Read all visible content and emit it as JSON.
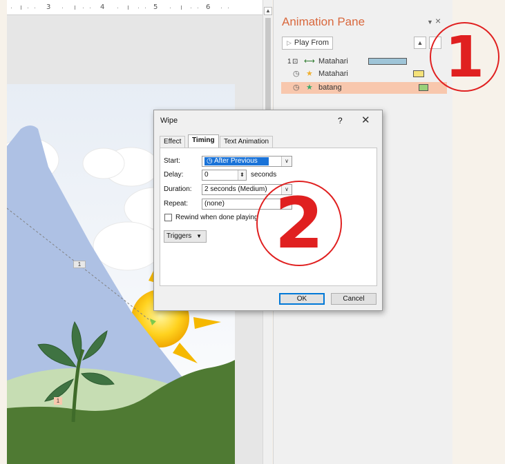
{
  "ruler": {
    "labels": [
      "3",
      "4",
      "5",
      "6"
    ]
  },
  "slide": {
    "tags": [
      "1",
      "1"
    ]
  },
  "animation_pane": {
    "title": "Animation Pane",
    "dropdown_icon": "chevron-down-icon",
    "close_icon": "close-icon",
    "play_from_label": "Play From",
    "items": [
      {
        "number": "1",
        "icon": "mouse-click-icon",
        "effect_icon": "motion-path-icon",
        "label": "Matahari",
        "bar_color": "#9fc5d8"
      },
      {
        "number": "",
        "icon": "clock-icon",
        "effect_icon": "star-icon",
        "label": "Matahari",
        "bar_color": "#f5e27a"
      },
      {
        "number": "",
        "icon": "clock-icon",
        "effect_icon": "star-icon",
        "label": "batang",
        "bar_color": "#9ad17a",
        "selected": true
      }
    ]
  },
  "annotations": [
    "1",
    "2"
  ],
  "dialog": {
    "title": "Wipe",
    "help": "?",
    "close": "✕",
    "tabs": [
      "Effect",
      "Timing",
      "Text Animation"
    ],
    "active_tab": "Timing",
    "start_label": "Start:",
    "start_value": "After Previous",
    "delay_label": "Delay:",
    "delay_value": "0",
    "delay_unit": "seconds",
    "duration_label": "Duration:",
    "duration_value": "2 seconds (Medium)",
    "repeat_label": "Repeat:",
    "repeat_value": "(none)",
    "rewind_label": "Rewind when done playing",
    "rewind_checked": false,
    "triggers_label": "Triggers",
    "ok_label": "OK",
    "cancel_label": "Cancel"
  },
  "colors": {
    "accent": "#d9683d",
    "selection": "#f8c7ad",
    "annotation": "#e02020",
    "highlight": "#1a73d8"
  }
}
